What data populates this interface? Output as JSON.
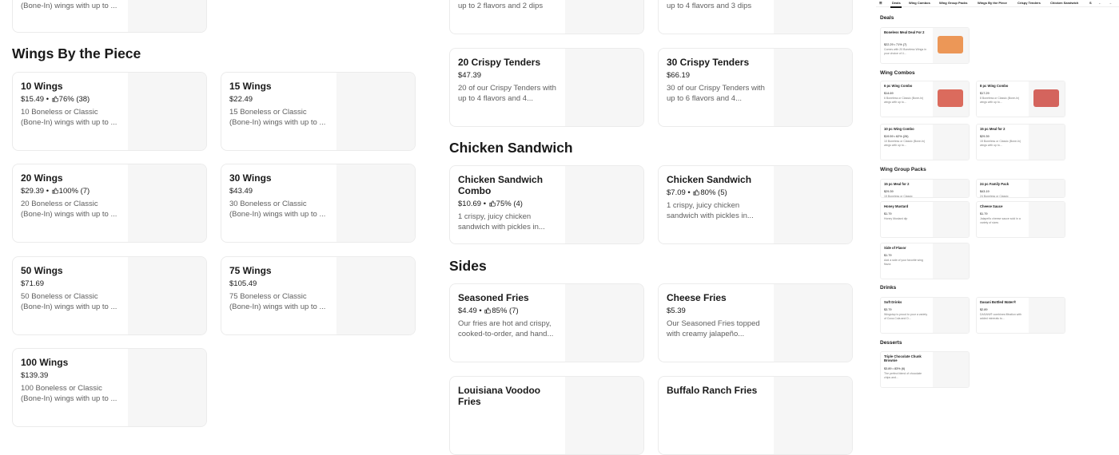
{
  "colors": {
    "text": "#191919",
    "muted": "#606060",
    "border": "#ebebeb",
    "thumb_bg": "#f6f6f6"
  },
  "top_cutoff": {
    "left_desc": "(Bone-In) wings with up to ...",
    "mid1_desc": "up to 2 flavors and 2 dips",
    "mid2_desc": "up to 4 flavors and 3 dips"
  },
  "wings_by_piece": {
    "heading": "Wings By the Piece",
    "items": [
      {
        "name": "10 Wings",
        "price": "$15.49",
        "rating": "76% (38)",
        "desc": "10 Boneless or Classic (Bone-In) wings with up to ..."
      },
      {
        "name": "15 Wings",
        "price": "$22.49",
        "rating": "",
        "desc": "15 Boneless or Classic (Bone-In) wings with up to ..."
      },
      {
        "name": "20 Wings",
        "price": "$29.39",
        "rating": "100% (7)",
        "desc": "20 Boneless or Classic (Bone-In) wings with up to ..."
      },
      {
        "name": "30 Wings",
        "price": "$43.49",
        "rating": "",
        "desc": "30 Boneless or Classic (Bone-In) wings with up to ..."
      },
      {
        "name": "50 Wings",
        "price": "$71.69",
        "rating": "",
        "desc": "50 Boneless or Classic (Bone-In) wings with up to ..."
      },
      {
        "name": "75 Wings",
        "price": "$105.49",
        "rating": "",
        "desc": "75 Boneless or Classic (Bone-In) wings with up to ..."
      },
      {
        "name": "100 Wings",
        "price": "$139.39",
        "rating": "",
        "desc": "100 Boneless or Classic (Bone-In) wings with up to ..."
      }
    ]
  },
  "tenders": {
    "items": [
      {
        "name": "20 Crispy Tenders",
        "price": "$47.39",
        "rating": "",
        "desc": "20 of our Crispy Tenders with up to 4 flavors and 4..."
      },
      {
        "name": "30 Crispy Tenders",
        "price": "$66.19",
        "rating": "",
        "desc": "30 of our Crispy Tenders with up to 6 flavors and 4..."
      }
    ]
  },
  "chicken_sandwich": {
    "heading": "Chicken Sandwich",
    "items": [
      {
        "name": "Chicken Sandwich Combo",
        "price": "$10.69",
        "rating": "75% (4)",
        "desc": "1 crispy, juicy chicken sandwich with pickles in..."
      },
      {
        "name": "Chicken Sandwich",
        "price": "$7.09",
        "rating": "80% (5)",
        "desc": "1 crispy, juicy chicken sandwich with pickles in..."
      }
    ]
  },
  "sides": {
    "heading": "Sides",
    "items": [
      {
        "name": "Seasoned Fries",
        "price": "$4.49",
        "rating": "85% (7)",
        "desc": "Our fries are hot and crispy, cooked-to-order, and hand..."
      },
      {
        "name": "Cheese Fries",
        "price": "$5.39",
        "rating": "",
        "desc": "Our Seasoned Fries topped with creamy jalapeño..."
      },
      {
        "name": "Louisiana Voodoo Fries",
        "price": "",
        "rating": "",
        "desc": ""
      },
      {
        "name": "Buffalo Ranch Fries",
        "price": "",
        "rating": "",
        "desc": ""
      }
    ]
  },
  "mini": {
    "tabs": [
      "Deals",
      "Wing Combos",
      "Wing Group Packs",
      "Wings By the Piece",
      "Crispy Tenders",
      "Chicken Sandwich",
      "S"
    ],
    "sections": {
      "deals": "Deals",
      "wing_combos": "Wing Combos",
      "wing_group_packs": "Wing Group Packs",
      "drinks": "Drinks",
      "desserts": "Desserts"
    },
    "cards": [
      {
        "name": "Boneless Meal Deal For 2",
        "price": "$22.29 • 71% (7)",
        "desc": "Comes with 20 Boneless Wings in your choice of 4..."
      },
      {
        "name": "6 pc Wing Combo",
        "price": "$14.69",
        "desc": "6 Boneless or Classic (Bone-In) wings with up to..."
      },
      {
        "name": "8 pc Wing Combo",
        "price": "$17.29",
        "desc": "8 Boneless or Classic (Bone-In) wings with up to..."
      },
      {
        "name": "10 pc Wing Combo",
        "price": "$19.59 • 62% (26)",
        "desc": "10 Boneless or Classic (Bone-In) wings with up to..."
      },
      {
        "name": "15 pc Meal for 2",
        "price": "$29.39",
        "desc": "15 Boneless or Classic (Bone-In) wings with up to..."
      },
      {
        "name": "15 pc Meal for 2",
        "price": "$29.39",
        "desc": "15 Boneless or Classic"
      },
      {
        "name": "24 pc Family Pack",
        "price": "$43.19",
        "desc": "24 Boneless or Classic"
      },
      {
        "name": "Honey Mustard",
        "price": "$1.79",
        "desc": "Honey Mustard dip"
      },
      {
        "name": "Cheese Sauce",
        "price": "$1.79",
        "desc": "Jalapeño cheese sauce sold in a variety of sizes"
      },
      {
        "name": "Side of Flavor",
        "price": "$1.79",
        "desc": "Add a side of your favorite wing flavor."
      },
      {
        "name": "Soft Drinks",
        "price": "$3.79",
        "desc": "Wingstop is proud to pour a variety of Coca-Cola and D..."
      },
      {
        "name": "Dasani Bottled Water®",
        "price": "$2.89",
        "desc": "DASANI® combines filtration with added minerals to..."
      },
      {
        "name": "Triple Chocolate Chunk Brownie",
        "price": "$3.89 • 83% (6)",
        "desc": "The perfect blend of chocolate chips and..."
      }
    ]
  }
}
